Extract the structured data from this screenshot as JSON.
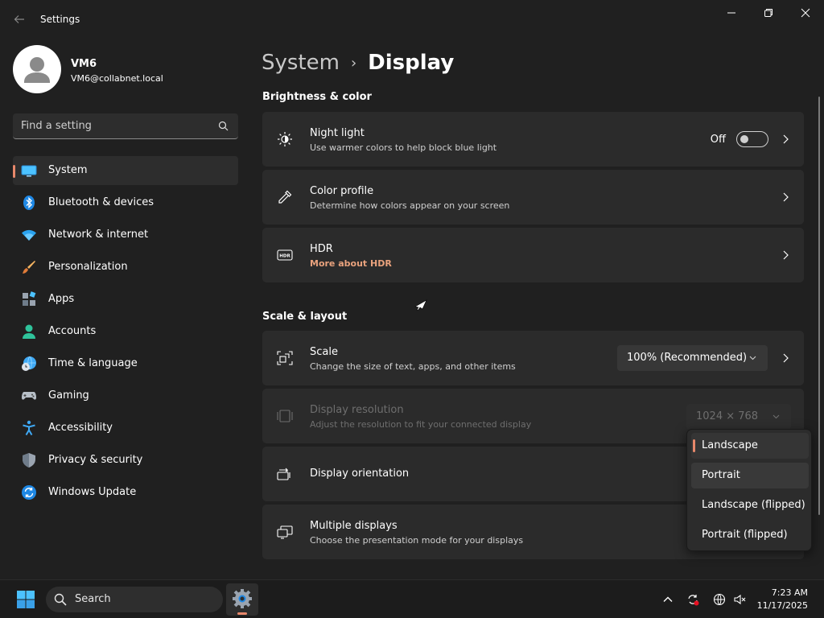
{
  "titlebar": {
    "title": "Settings"
  },
  "profile": {
    "name": "VM6",
    "email": "VM6@collabnet.local"
  },
  "search": {
    "placeholder": "Find a setting"
  },
  "nav": {
    "items": [
      {
        "label": "System",
        "icon": "monitor-icon"
      },
      {
        "label": "Bluetooth & devices",
        "icon": "bluetooth-icon"
      },
      {
        "label": "Network & internet",
        "icon": "wifi-icon"
      },
      {
        "label": "Personalization",
        "icon": "brush-icon"
      },
      {
        "label": "Apps",
        "icon": "apps-icon"
      },
      {
        "label": "Accounts",
        "icon": "person-icon"
      },
      {
        "label": "Time & language",
        "icon": "globe-clock-icon"
      },
      {
        "label": "Gaming",
        "icon": "gamepad-icon"
      },
      {
        "label": "Accessibility",
        "icon": "accessibility-icon"
      },
      {
        "label": "Privacy & security",
        "icon": "shield-icon"
      },
      {
        "label": "Windows Update",
        "icon": "update-icon"
      }
    ]
  },
  "breadcrumb": {
    "parent": "System",
    "separator": "›",
    "current": "Display"
  },
  "sections": {
    "brightness": "Brightness & color",
    "scale": "Scale & layout"
  },
  "cards": {
    "night_light": {
      "title": "Night light",
      "subtitle": "Use warmer colors to help block blue light",
      "state": "Off"
    },
    "color_profile": {
      "title": "Color profile",
      "subtitle": "Determine how colors appear on your screen"
    },
    "hdr": {
      "title": "HDR",
      "subtitle": "More about HDR"
    },
    "scale": {
      "title": "Scale",
      "subtitle": "Change the size of text, apps, and other items",
      "value": "100% (Recommended)"
    },
    "resolution": {
      "title": "Display resolution",
      "subtitle": "Adjust the resolution to fit your connected display",
      "value": "1024 × 768"
    },
    "orientation": {
      "title": "Display orientation"
    },
    "multiple": {
      "title": "Multiple displays",
      "subtitle": "Choose the presentation mode for your displays"
    }
  },
  "orientation_dropdown": {
    "options": [
      "Landscape",
      "Portrait",
      "Landscape (flipped)",
      "Portrait (flipped)"
    ],
    "selected": "Landscape",
    "hovered": "Portrait"
  },
  "taskbar": {
    "search_label": "Search",
    "time": "7:23 AM",
    "date": "11/17/2025"
  },
  "colors": {
    "accent": "#e8886b",
    "link": "#e9a27d",
    "background": "#202020",
    "card": "#2b2b2b"
  }
}
